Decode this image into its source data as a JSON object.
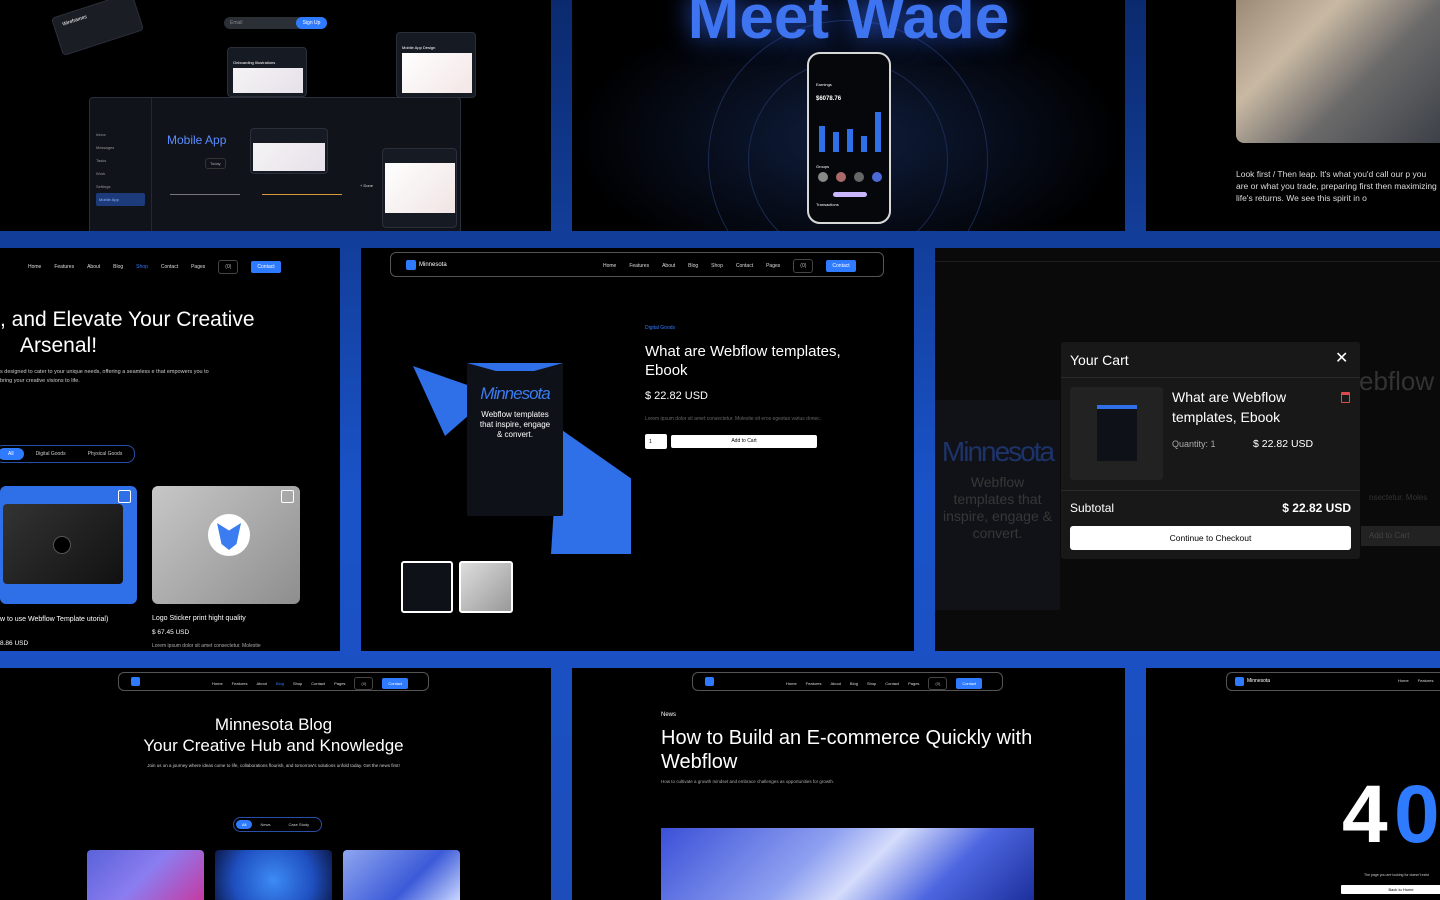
{
  "colors": {
    "accent": "#2f7bff",
    "background": "#000000",
    "frame": "#1d4fb8"
  },
  "tile_dashboard": {
    "email_placeholder": "Email",
    "signup_label": "Sign Up",
    "mobile_app_title": "Mobile App",
    "onboarding_label": "Onboarding Illustrations",
    "mobile_design_label": "Mobile App Design",
    "sidebar_items": [
      "Inbox",
      "Messages",
      "Tasks",
      "Work",
      "Settings"
    ],
    "today_label": "Today",
    "done_label": "+ Done",
    "wireframes_label": "Wireframes",
    "mobile_app_small": "Mobile App"
  },
  "tile_wade": {
    "headline": "Meet Wade",
    "phone": {
      "earnings_label": "Earnings",
      "earnings_value": "$6078.76",
      "groups_label": "Groups",
      "transactions_label": "Transactions"
    }
  },
  "tile_office": {
    "paragraph": "Look first / Then leap. It's what you'd call our p you are or what you trade, preparing first then maximizing life's returns. We see this spirit in o"
  },
  "tile_shop": {
    "nav": [
      "Home",
      "Features",
      "About",
      "Blog",
      "Shop",
      "Contact",
      "Pages"
    ],
    "cart": "(0)",
    "contact": "Contact",
    "headline_1": ", and Elevate Your Creative",
    "headline_2": "Arsenal!",
    "subtext": "s designed to cater to your unique needs, offering a seamless e that empowers you to bring your creative visions to life.",
    "filters": [
      "All",
      "Digital Goods",
      "Physical Goods"
    ],
    "product1_title": "w to use Webflow Template utorial)",
    "product1_price": "8.86 USD",
    "product2_title": "Logo Sticker print hight quality",
    "product2_price": "$ 67.45 USD",
    "product2_desc": "Lorem ipsum dolor sit amet consectetur. Molestie"
  },
  "tile_product": {
    "brand": "Minnesota",
    "nav": [
      "Home",
      "Features",
      "About",
      "Blog",
      "Shop",
      "Contact",
      "Pages"
    ],
    "cart": "(0)",
    "contact": "Contact",
    "category": "Digital Goods",
    "title": "What are Webflow templates, Ebook",
    "price": "$ 22.82 USD",
    "description": "Lorem ipsum dolor sit amet consectetur. Molestie sit eros egestas varius donec.",
    "qty": "1",
    "add_to_cart": "Add to Cart",
    "book_brand": "Minnesota",
    "book_text": "Webflow templates that inspire, engage & convert."
  },
  "tile_cart": {
    "title": "Your Cart",
    "item_title": "What are Webflow templates, Ebook",
    "quantity": "Quantity: 1",
    "item_price": "$ 22.82 USD",
    "subtotal_label": "Subtotal",
    "subtotal_value": "$ 22.82 USD",
    "checkout": "Continue to Checkout",
    "bg_title": "ebflow",
    "bg_book_brand": "Minnesota",
    "bg_book_text": "Webflow templates that inspire, engage & convert.",
    "bg_add": "Add to Cart",
    "bg_desc": "nsectetur. Moles"
  },
  "tile_blog": {
    "nav": [
      "Home",
      "Features",
      "About",
      "Blog",
      "Shop",
      "Contact",
      "Pages"
    ],
    "cart": "(0)",
    "contact": "Contact",
    "title_1": "Minnesota Blog",
    "title_2": "Your Creative Hub and Knowledge",
    "subtitle": "Join us on a journey where ideas come to life, collaborations flourish, and tomorrow's solutions unfold today. Get the news first!",
    "filters": [
      "All",
      "News",
      "Case Study"
    ]
  },
  "tile_article": {
    "nav": [
      "Home",
      "Features",
      "About",
      "Blog",
      "Shop",
      "Contact",
      "Pages"
    ],
    "cart": "(0)",
    "contact": "Contact",
    "tag": "News",
    "title": "How to Build an E-commerce Quickly with Webflow",
    "subtitle": "How to cultivate a growth mindset and embrace challenges as opportunities for growth."
  },
  "tile_404": {
    "brand": "Minnesota",
    "nav": [
      "Home",
      "Features"
    ],
    "big_4": "4",
    "big_0": "0",
    "text": "The page you are looking for doesn't exist",
    "back": "Back to Home"
  }
}
